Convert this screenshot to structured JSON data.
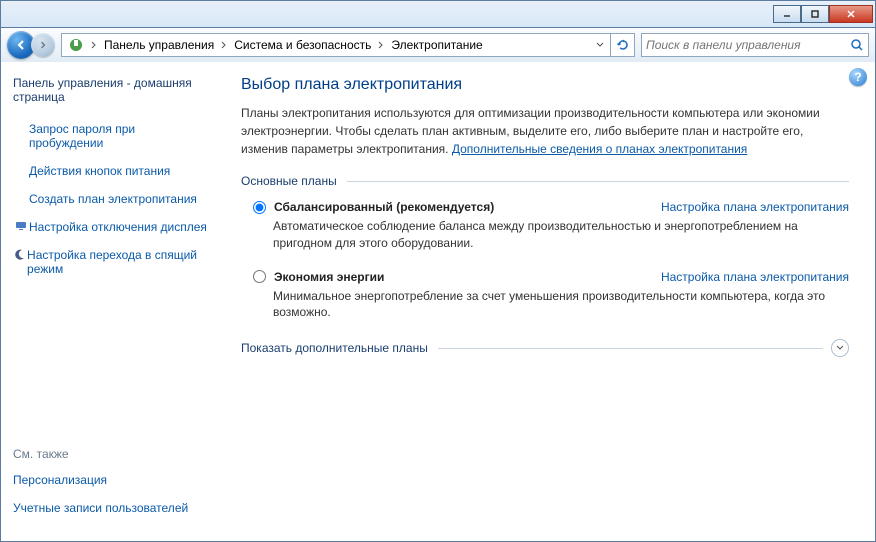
{
  "breadcrumb": {
    "items": [
      "Панель управления",
      "Система и безопасность",
      "Электропитание"
    ]
  },
  "search": {
    "placeholder": "Поиск в панели управления"
  },
  "sidebar": {
    "home": "Панель управления - домашняя страница",
    "links": [
      "Запрос пароля при пробуждении",
      "Действия кнопок питания",
      "Создать план электропитания",
      "Настройка отключения дисплея",
      "Настройка перехода в спящий режим"
    ],
    "see_also_hdr": "См. также",
    "see_also": [
      "Персонализация",
      "Учетные записи пользователей"
    ]
  },
  "main": {
    "title": "Выбор плана электропитания",
    "desc_before_link": "Планы электропитания используются для оптимизации производительности компьютера или экономии электроэнергии. Чтобы сделать план активным, выделите его, либо выберите план и настройте его, изменив параметры электропитания. ",
    "desc_link": "Дополнительные сведения о планах электропитания",
    "group_main": "Основные планы",
    "group_extra": "Показать дополнительные планы",
    "plans": [
      {
        "name": "Сбалансированный (рекомендуется)",
        "desc": "Автоматическое соблюдение баланса между производительностью и энергопотреблением на пригодном для этого оборудовании.",
        "selected": true,
        "cfg": "Настройка плана электропитания"
      },
      {
        "name": "Экономия энергии",
        "desc": "Минимальное энергопотребление за счет уменьшения производительности компьютера, когда это возможно.",
        "selected": false,
        "cfg": "Настройка плана электропитания"
      }
    ]
  }
}
